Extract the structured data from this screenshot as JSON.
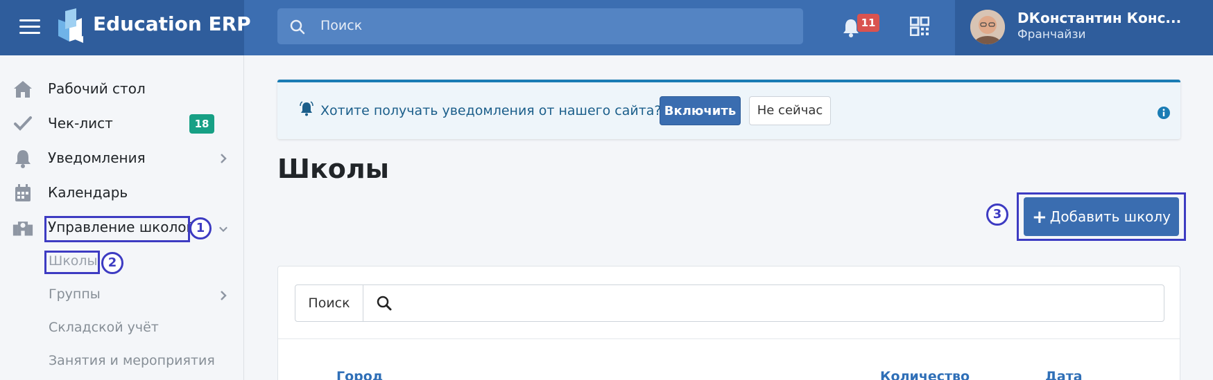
{
  "header": {
    "app_title": "Education ERP",
    "search_placeholder": "Поиск",
    "notifications_count": "11",
    "user_name": "DКонстантин Конс...",
    "user_role": "Франчайзи"
  },
  "sidebar": {
    "items": [
      {
        "label": "Рабочий стол",
        "icon": "home-icon"
      },
      {
        "label": "Чек-лист",
        "icon": "check-icon",
        "badge": "18"
      },
      {
        "label": "Уведомления",
        "icon": "bell-icon"
      },
      {
        "label": "Календарь",
        "icon": "calendar-icon"
      },
      {
        "label": "Управление школой",
        "icon": "school-icon"
      }
    ],
    "subitems": [
      {
        "label": "Школы"
      },
      {
        "label": "Группы"
      },
      {
        "label": "Складской учёт"
      },
      {
        "label": "Занятия и мероприятия"
      }
    ]
  },
  "notice": {
    "text": "Хотите получать уведомления от нашего сайта?",
    "enable_label": "Включить",
    "later_label": "Не сейчас"
  },
  "main": {
    "title": "Школы",
    "add_button_label": "Добавить школу",
    "search_label": "Поиск",
    "columns": [
      "Город",
      "Количество",
      "Дата"
    ]
  },
  "annotations": {
    "step1": "1",
    "step2": "2",
    "step3": "3"
  },
  "colors": {
    "topbar": "#3c6eb1",
    "brand_bg": "#2f5d9c",
    "primary_button": "#3a6db0",
    "badge_green": "#17a085",
    "badge_red": "#d9534f",
    "annotation": "#3d3bc2"
  }
}
